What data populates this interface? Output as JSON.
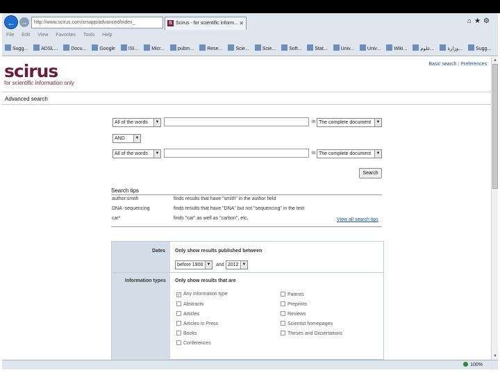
{
  "browser": {
    "address": "http://www.scirus.com/srsapp/advanced/index_",
    "tab_title": "Scirus - for scientific inform...",
    "tab_icon_letter": "S",
    "menu": [
      "File",
      "Edit",
      "View",
      "Favorites",
      "Tools",
      "Help"
    ],
    "favorites": [
      "Sugg...",
      "ADSL...",
      "Docu...",
      "Google",
      "ISI...",
      "Micr...",
      "pubm...",
      "Rese...",
      "Scie...",
      "Scie...",
      "Soft...",
      "Stat...",
      "Univ...",
      "Univ...",
      "Wiki...",
      "علوم...",
      "وزارة...",
      "Sugg..."
    ],
    "zoom": "100%"
  },
  "site": {
    "logo": "scirus",
    "tagline": "for scientific information only",
    "links": {
      "basic": "Basic search",
      "separator": "|",
      "preferences": "Preferences"
    },
    "heading": "Advanced search"
  },
  "query": {
    "row1_mode": "All of the words",
    "row1_field": "The complete document",
    "operator": "AND",
    "row2_mode": "All of the words",
    "row2_field": "The complete document",
    "in_label": "in",
    "search_button": "Search"
  },
  "tips": {
    "title": "Search tips",
    "items": [
      {
        "example": "author:smith",
        "desc": "finds results that have \"smith\" in the author field"
      },
      {
        "example": "DNA -sequencing",
        "desc": "finds results that have \"DNA\" but not \"sequencing\" in the text"
      },
      {
        "example": "car*",
        "desc": "finds \"car\" as well as \"carbon\", etc."
      }
    ],
    "view_all": "View all search tips"
  },
  "filters": {
    "dates": {
      "label": "Dates",
      "note": "Only show results published between",
      "from": "before 1900",
      "and": "and",
      "to": "2012"
    },
    "types": {
      "label": "Information types",
      "note": "Only show results that are",
      "left": [
        "Any information type",
        "Abstracts",
        "Articles",
        "Articles in Press",
        "Books",
        "Conferences"
      ],
      "right": [
        "Patents",
        "Preprints",
        "Reviews",
        "Scientist homepages",
        "Theses and Dissertations"
      ]
    }
  }
}
